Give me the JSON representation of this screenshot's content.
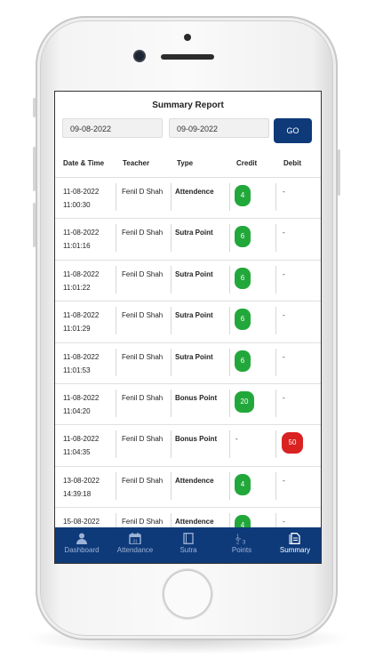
{
  "screen": {
    "title": "Summary Report",
    "from_date": "09-08-2022",
    "to_date": "09-09-2022",
    "go_label": "GO"
  },
  "table": {
    "headers": [
      "Date & Time",
      "Teacher",
      "Type",
      "Credit",
      "Debit"
    ],
    "rows": [
      {
        "date": "11-08-2022",
        "time": "11:00:30",
        "teacher": "Fenil D Shah",
        "type": "Attendence",
        "credit": "4",
        "debit": "-"
      },
      {
        "date": "11-08-2022",
        "time": "11:01:16",
        "teacher": "Fenil D Shah",
        "type": "Sutra Point",
        "credit": "6",
        "debit": "-"
      },
      {
        "date": "11-08-2022",
        "time": "11:01:22",
        "teacher": "Fenil D Shah",
        "type": "Sutra Point",
        "credit": "6",
        "debit": "-"
      },
      {
        "date": "11-08-2022",
        "time": "11:01:29",
        "teacher": "Fenil D Shah",
        "type": "Sutra Point",
        "credit": "6",
        "debit": "-"
      },
      {
        "date": "11-08-2022",
        "time": "11:01:53",
        "teacher": "Fenil D Shah",
        "type": "Sutra Point",
        "credit": "6",
        "debit": "-"
      },
      {
        "date": "11-08-2022",
        "time": "11:04:20",
        "teacher": "Fenil D Shah",
        "type": "Bonus Point",
        "credit": "20",
        "debit": "-"
      },
      {
        "date": "11-08-2022",
        "time": "11:04:35",
        "teacher": "Fenil D Shah",
        "type": "Bonus Point",
        "credit": "-",
        "debit": "50"
      },
      {
        "date": "13-08-2022",
        "time": "14:39:18",
        "teacher": "Fenil D Shah",
        "type": "Attendence",
        "credit": "4",
        "debit": "-"
      },
      {
        "date": "15-08-2022",
        "time": "",
        "teacher": "Fenil D Shah",
        "type": "Attendence",
        "credit": "4",
        "debit": "-"
      }
    ]
  },
  "tabs": [
    {
      "label": "Dashboard",
      "icon": "person-icon"
    },
    {
      "label": "Attendance",
      "icon": "calendar-icon"
    },
    {
      "label": "Sutra",
      "icon": "book-icon"
    },
    {
      "label": "Points",
      "icon": "numbers-icon"
    },
    {
      "label": "Summary",
      "icon": "document-icon"
    }
  ],
  "colors": {
    "brand": "#0e3a7a",
    "credit_badge": "#22a83a",
    "debit_badge": "#d92222"
  }
}
